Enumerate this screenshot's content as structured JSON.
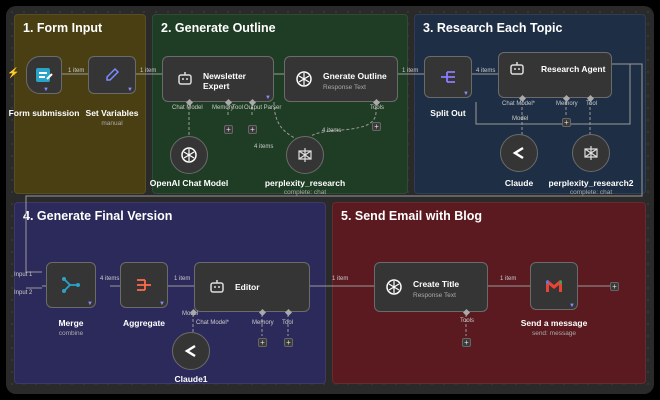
{
  "sections": [
    {
      "title": "1. Form Input",
      "color": "#4a3f12"
    },
    {
      "title": "2. Generate Outline",
      "color": "#1f3d24"
    },
    {
      "title": "3. Research Each Topic",
      "color": "#1e2e44"
    },
    {
      "title": "4. Generate Final Version",
      "color": "#2c2a5a"
    },
    {
      "title": "5. Send Email with Blog",
      "color": "#5a1a20"
    }
  ],
  "nodes": {
    "form_submission": {
      "label": "Form submission"
    },
    "set_variables": {
      "label": "Set Variables",
      "sub": "manual"
    },
    "newsletter_expert": {
      "label": "Newsletter Expert"
    },
    "generate_outline": {
      "label": "Gnerate Outline",
      "sub": "Response Text"
    },
    "split_out": {
      "label": "Split Out"
    },
    "research_agent": {
      "label": "Research Agent"
    },
    "openai_chat_model": {
      "label": "OpenAI Chat Model"
    },
    "perplexity_research": {
      "label": "perplexity_research",
      "sub": "complete: chat"
    },
    "claude": {
      "label": "Claude"
    },
    "perplexity_research2": {
      "label": "perplexity_research2",
      "sub": "complete: chat"
    },
    "merge": {
      "label": "Merge",
      "sub": "combine"
    },
    "aggregate": {
      "label": "Aggregate"
    },
    "editor": {
      "label": "Editor"
    },
    "claude1": {
      "label": "Claude1"
    },
    "create_title": {
      "label": "Create Title",
      "sub": "Response Text"
    },
    "send_message": {
      "label": "Send a message",
      "sub": "send: message"
    }
  },
  "ports": {
    "chat_model": "Chat Model",
    "chat_model_req": "Chat Model*",
    "memory": "Memory",
    "tool": "Tool",
    "tools": "Tools",
    "output_parser": "Output Parser",
    "model": "Model",
    "input1": "Input 1",
    "input2": "Input 2"
  },
  "edge_labels": {
    "one_item": "1 item",
    "four_items": "4 items"
  },
  "colors": {
    "pin": "#8b8bff",
    "trigger_bolt": "#ff6b4a"
  }
}
